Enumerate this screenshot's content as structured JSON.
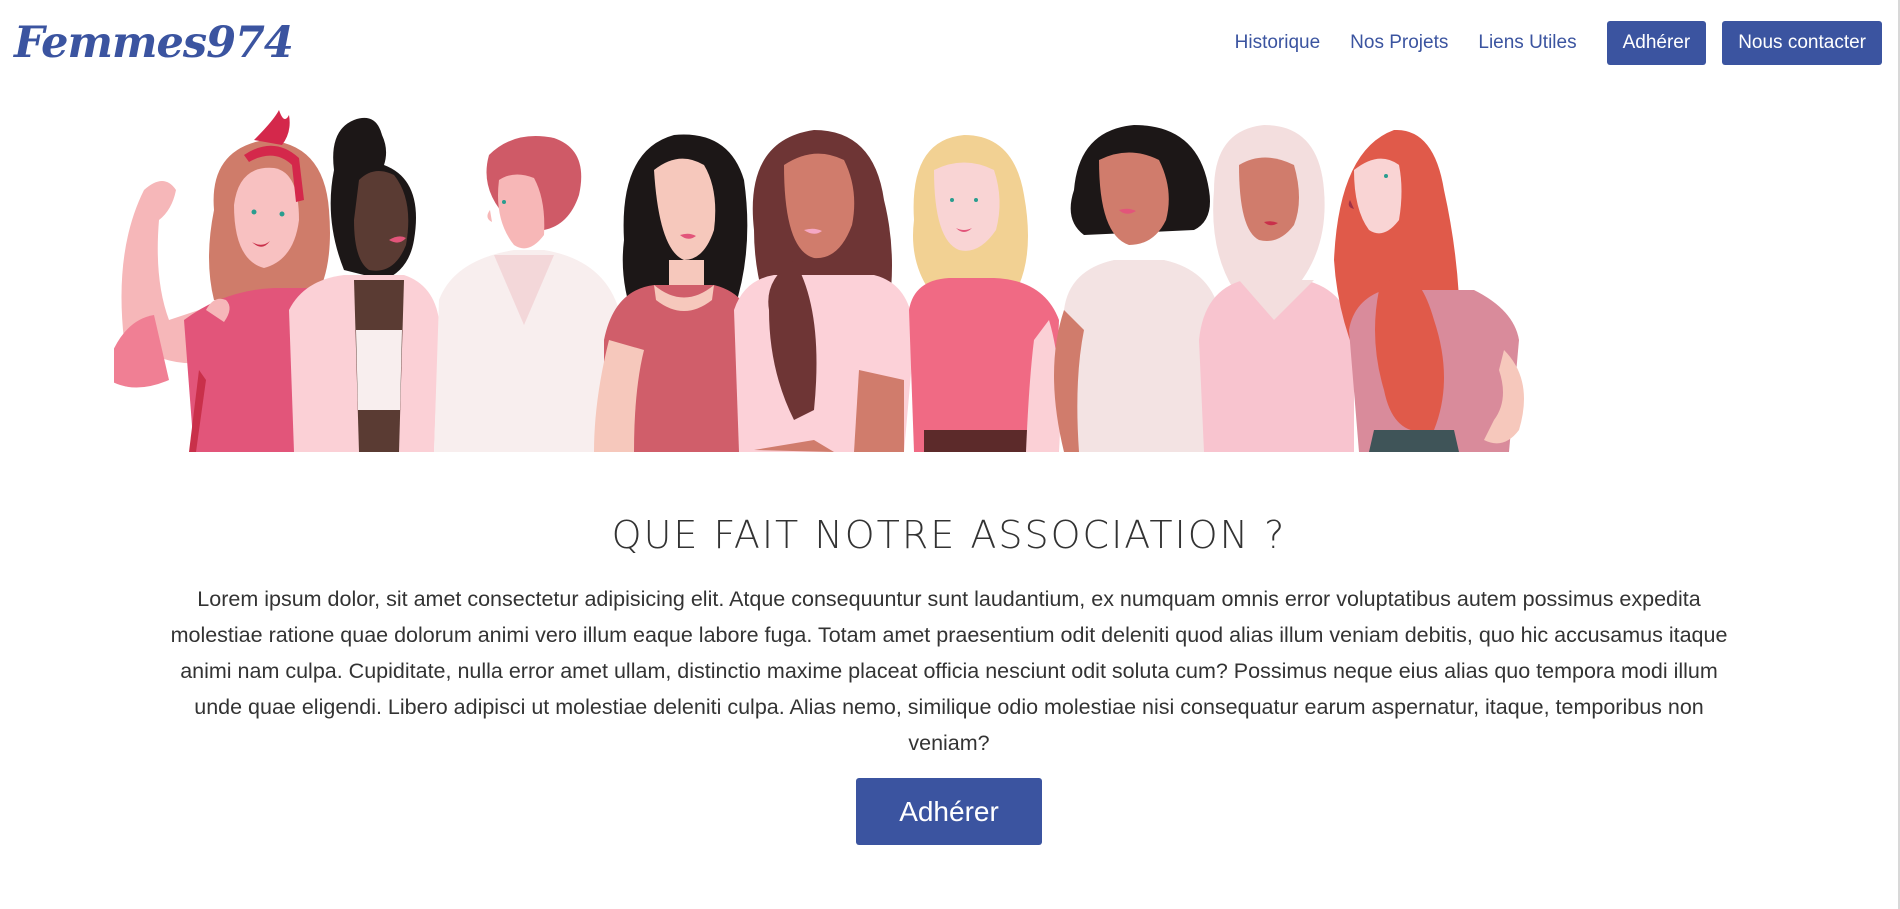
{
  "navbar": {
    "brand": "Femmes974",
    "links": [
      "Historique",
      "Nos Projets",
      "Liens Utiles"
    ],
    "join_button": "Adhérer",
    "contact_button": "Nous contacter"
  },
  "hero": {
    "illustration": "group-of-women-illustration"
  },
  "section": {
    "title": "QUE FAIT NOTRE ASSOCIATION ?",
    "text": "Lorem ipsum dolor, sit amet consectetur adipisicing elit. Atque consequuntur sunt laudantium, ex numquam omnis error voluptatibus autem possimus expedita molestiae ratione quae dolorum animi vero illum eaque labore fuga. Totam amet praesentium odit deleniti quod alias illum veniam debitis, quo hic accusamus itaque animi nam culpa. Cupiditate, nulla error amet ullam, distinctio maxime placeat officia nesciunt odit soluta cum? Possimus neque eius alias quo tempora modi illum unde quae eligendi. Libero adipisci ut molestiae deleniti culpa. Alias nemo, similique odio molestiae nisi consequatur earum aspernatur, itaque, temporibus non veniam?",
    "join_button": "Adhérer"
  },
  "colors": {
    "primary": "#3b54a0",
    "text": "#333333",
    "background": "#ffffff"
  }
}
